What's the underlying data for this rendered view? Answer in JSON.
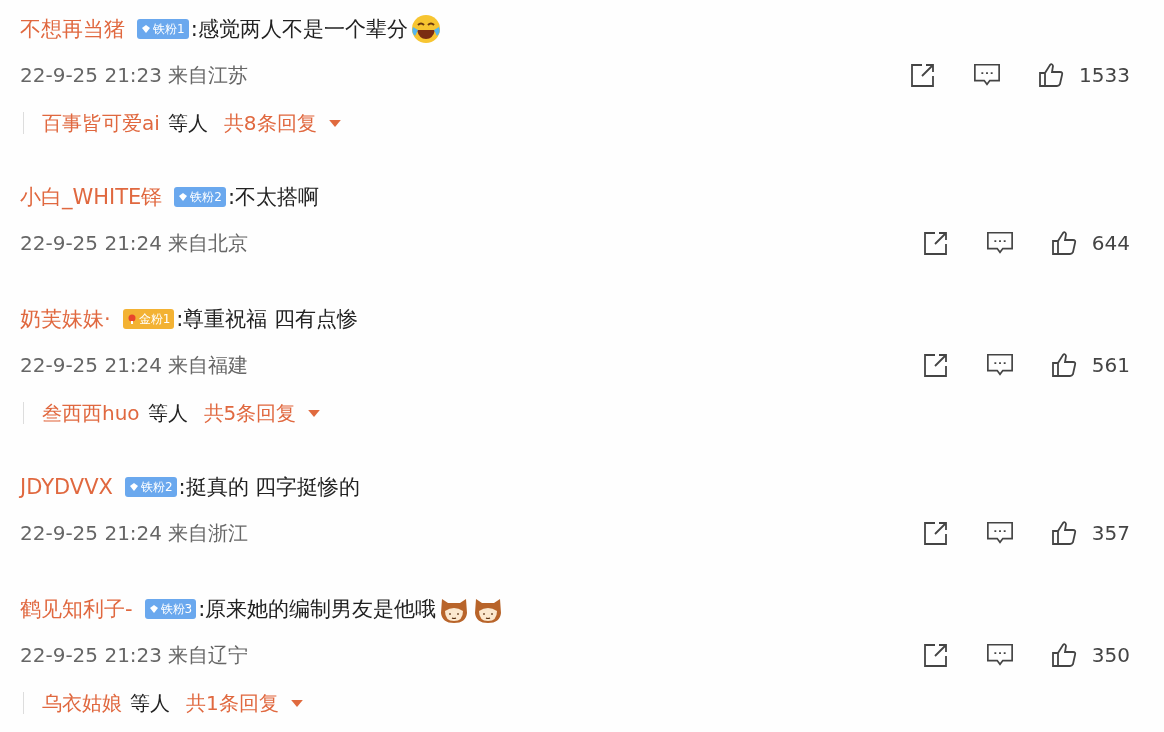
{
  "comments": [
    {
      "user": "不想再当猪",
      "badge": {
        "kind": "iron",
        "label": "铁粉1"
      },
      "text": ":感觉两人不是一个辈分",
      "emojis": [
        {
          "kind": "laugh"
        }
      ],
      "time": "22-9-25 21:23",
      "location": "来自江苏",
      "likes": "1533",
      "replies": {
        "users": "百事皆可爱ai",
        "suffix": "等人",
        "count": "共8条回复"
      }
    },
    {
      "user": "小白_WHITE铎",
      "badge": {
        "kind": "iron",
        "label": "铁粉2"
      },
      "text": ":不太搭啊",
      "time": "22-9-25 21:24",
      "location": "来自北京",
      "likes": "644"
    },
    {
      "user": "奶芙妹妹·",
      "badge": {
        "kind": "gold",
        "label": "金粉1"
      },
      "text": ":尊重祝福 四有点惨",
      "time": "22-9-25 21:24",
      "location": "来自福建",
      "likes": "561",
      "replies": {
        "users": "叁西西huo",
        "suffix": "等人",
        "count": "共5条回复"
      }
    },
    {
      "user": "JDYDVVX",
      "badge": {
        "kind": "iron",
        "label": "铁粉2"
      },
      "text": ":挺真的 四字挺惨的",
      "time": "22-9-25 21:24",
      "location": "来自浙江",
      "likes": "357"
    },
    {
      "user": "鹤见知利子-",
      "badge": {
        "kind": "iron",
        "label": "铁粉3"
      },
      "text": ":原来她的编制男友是他哦",
      "emojis": [
        {
          "kind": "cat"
        },
        {
          "kind": "cat"
        }
      ],
      "time": "22-9-25 21:23",
      "location": "来自辽宁",
      "likes": "350",
      "replies": {
        "users": "乌衣姑娘",
        "suffix": "等人",
        "count": "共1条回复"
      }
    }
  ]
}
